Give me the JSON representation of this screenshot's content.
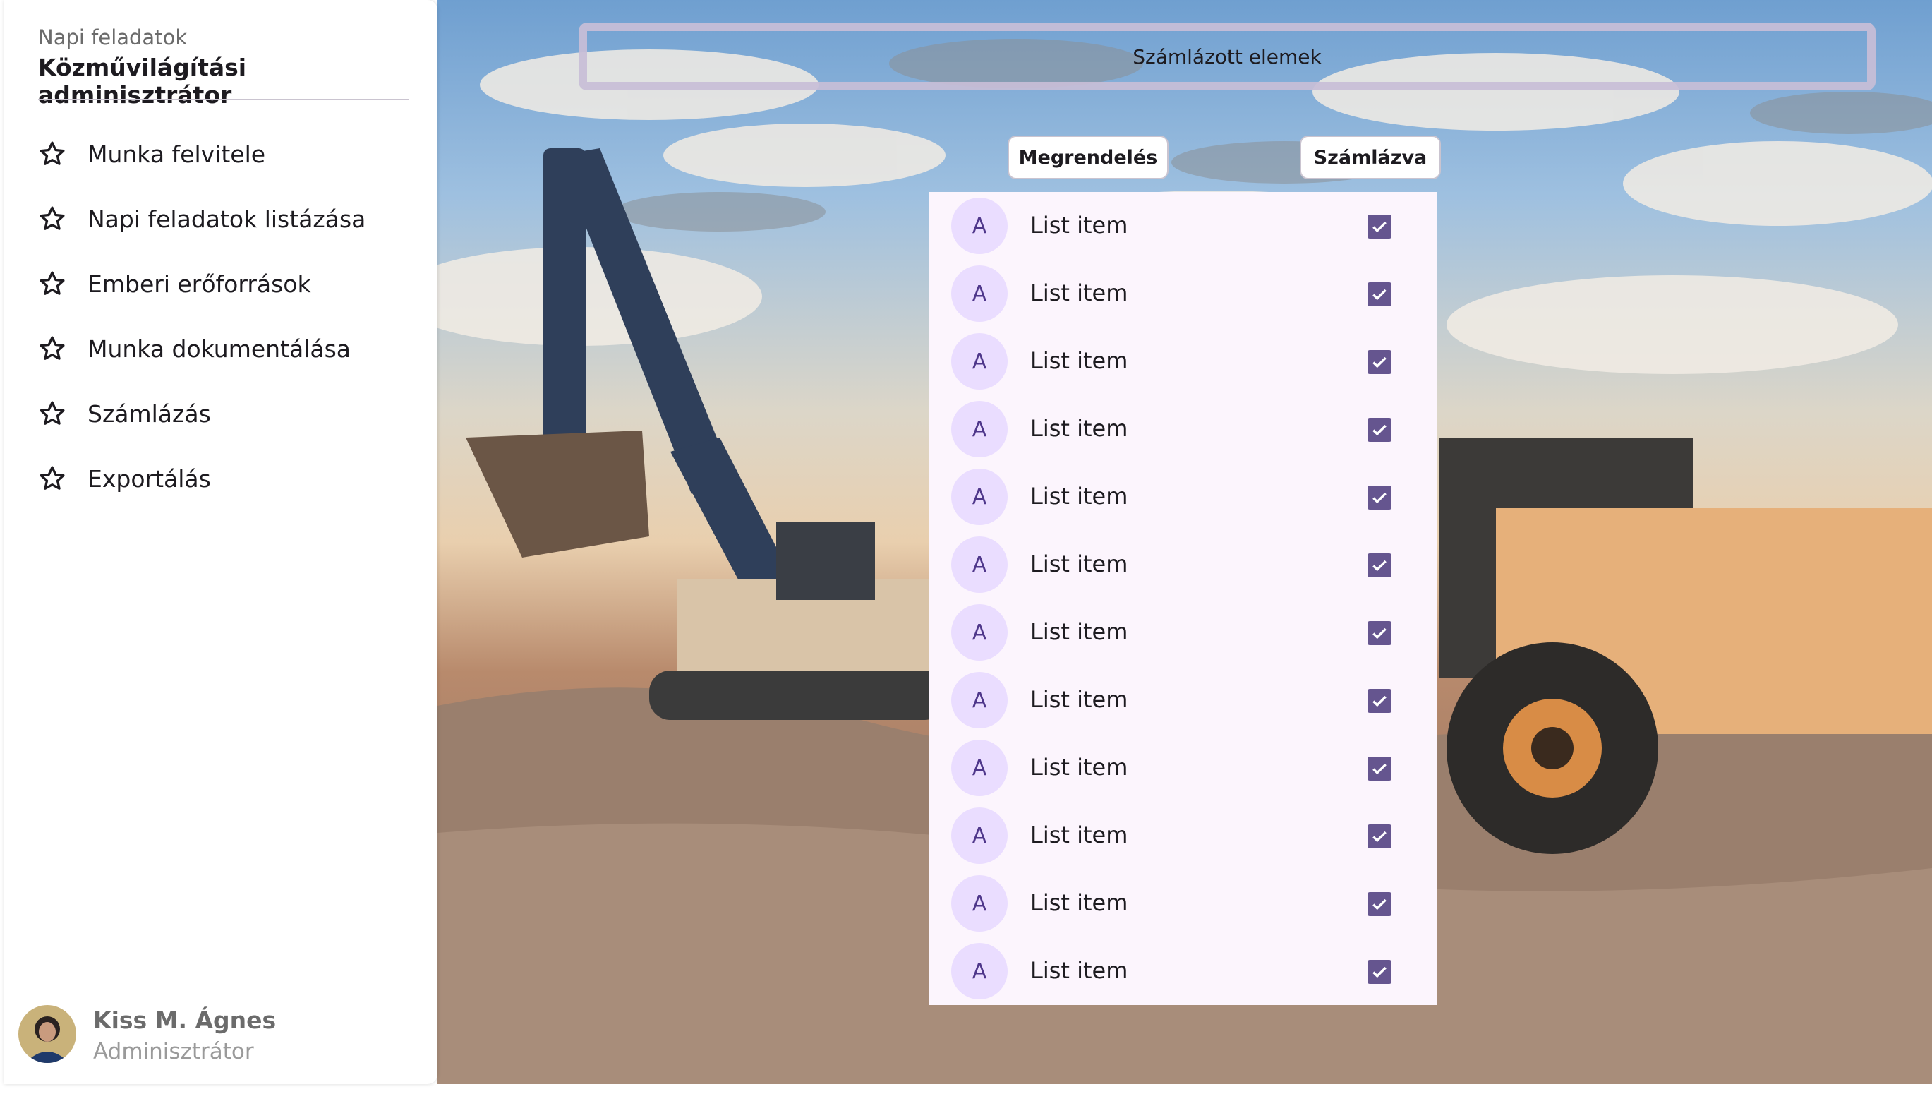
{
  "sidebar": {
    "subtitle": "Napi feladatok",
    "title": "Közművilágítási adminisztrátor",
    "items": [
      {
        "label": "Munka felvitele",
        "icon": "star-icon"
      },
      {
        "label": "Napi feladatok listázása",
        "icon": "star-icon"
      },
      {
        "label": "Emberi erőforrások",
        "icon": "star-icon"
      },
      {
        "label": "Munka dokumentálása",
        "icon": "star-icon"
      },
      {
        "label": "Számlázás",
        "icon": "star-icon"
      },
      {
        "label": "Exportálás",
        "icon": "star-icon"
      }
    ],
    "user": {
      "name": "Kiss M. Ágnes",
      "role": "Adminisztrátor"
    }
  },
  "banner": {
    "label": "Számlázott elemek"
  },
  "columns": {
    "order_label": "Megrendelés",
    "billed_label": "Számlázva"
  },
  "list": {
    "items": [
      {
        "avatar": "A",
        "label": "List item",
        "checked": true
      },
      {
        "avatar": "A",
        "label": "List item",
        "checked": true
      },
      {
        "avatar": "A",
        "label": "List item",
        "checked": true
      },
      {
        "avatar": "A",
        "label": "List item",
        "checked": true
      },
      {
        "avatar": "A",
        "label": "List item",
        "checked": true
      },
      {
        "avatar": "A",
        "label": "List item",
        "checked": true
      },
      {
        "avatar": "A",
        "label": "List item",
        "checked": true
      },
      {
        "avatar": "A",
        "label": "List item",
        "checked": true
      },
      {
        "avatar": "A",
        "label": "List item",
        "checked": true
      },
      {
        "avatar": "A",
        "label": "List item",
        "checked": true
      },
      {
        "avatar": "A",
        "label": "List item",
        "checked": true
      },
      {
        "avatar": "A",
        "label": "List item",
        "checked": true
      }
    ]
  },
  "colors": {
    "accent": "#65558f",
    "avatar_bg": "#eaddff",
    "list_bg": "#fcf5fd"
  }
}
